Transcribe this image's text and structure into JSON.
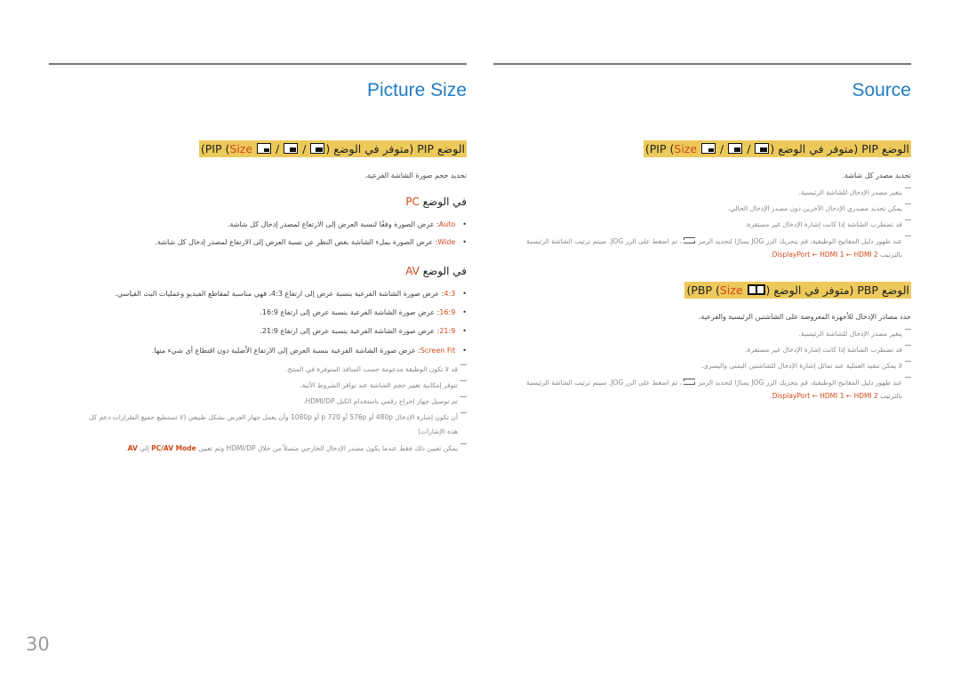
{
  "page_number": "30",
  "colors": {
    "title": "#1f7cc4",
    "highlight": "#ecc95a",
    "accent": "#d14a1a"
  },
  "left": {
    "title": "Picture Size",
    "heading": {
      "text": "الوضع PIP (متوفر في الوضع PIP (",
      "size_label": "Size",
      "sep": " / ",
      "close": "))"
    },
    "description": "تحديد حجم صورة الشاشة الفرعية.",
    "pc_heading": {
      "prefix": "في الوضع ",
      "mode": "PC"
    },
    "pc_items": [
      {
        "key": "Auto",
        "text": ": عرض الصورة وفقًا لنسبة العرض إلى الارتفاع لمصدر إدخال كل شاشة."
      },
      {
        "key": "Wide",
        "text": ": عرض الصورة بملء الشاشة بغض النظر عن نسبة العرض إلى الارتفاع لمصدر إدخال كل شاشة."
      }
    ],
    "av_heading": {
      "prefix": "في الوضع ",
      "mode": "AV"
    },
    "av_items": [
      {
        "key": "4:3",
        "text": ": عرض صورة الشاشة الفرعية بنسبة عرض إلى ارتفاع 4:3، فهي مناسبة لمقاطع الفيديو وعمليات البث القياسي."
      },
      {
        "key": "16:9",
        "text": ": عرض صورة الشاشة الفرعية بنسبة عرض إلى ارتفاع 16:9."
      },
      {
        "key": "21:9",
        "text": ": عرض صورة الشاشة الفرعية بنسبة عرض إلى ارتفاع 21:9."
      },
      {
        "key": "Screen Fit",
        "text": ": عرض صورة الشاشة الفرعية بنسبة العرض إلى الارتفاع الأصلية دون اقتطاع أي شيء منها."
      }
    ],
    "notes": [
      "قد لا تكون الوظيفة مدعومة حسب المنافذ المتوفرة في المنتج.",
      "تتوفر إمكانية تغيير حجم الشاشة عند توافر الشروط الآتية.",
      "تم توصيل جهاز إخراج رقمي باستخدام الكبل HDMI/DP.",
      "أن تكون إشارة الإدخال 480p أو 576p أو 720 p أو 1080p وأن يعمل جهاز العرض بشكل طبيعي (لا تستطيع جميع الطرازات دعم كل",
      "هذه الإشارات)"
    ],
    "last_note": {
      "text": "يمكن تعيين ذلك فقط عندما يكون مصدر الإدخال الخارجي متصلاً من خلال HDMI/DP وتم تعيين ",
      "key1": "PC/AV Mode",
      "mid": " إلى ",
      "key2": "AV",
      "end": "."
    }
  },
  "right": {
    "title": "Source",
    "pip_heading": {
      "text": "الوضع PIP (متوفر في الوضع PIP (",
      "size_label": "Size",
      "sep": " / ",
      "close": "))"
    },
    "pip_description": "تحديد مصدر كل شاشة.",
    "pip_notes": [
      "يتغير مصدر الإدخال للشاشة الرئيسية.",
      "يمكن تحديد مصدري الإدخال الآخرين دون مصدر الإدخال الحالي.",
      "قد تضطرب الشاشة إذا كانت إشارة الإدخال غير مستقرة."
    ],
    "pip_jog_note": {
      "before": "عند ظهور دليل المفاتيح الوظيفية، قم بتحريك الزر JOG يسارًا لتحديد الرمز ",
      "after": "، ثم اضغط على الزر JOG. سيتم ترتيب الشاشة الرئيسية",
      "line2_prefix": "بالترتيب ",
      "order": "DisplayPort ← HDMI 1 ← HDMI 2",
      "end": "."
    },
    "pbp_heading": {
      "text": "الوضع PBP (متوفر في الوضع PBP (",
      "size_label": "Size",
      "close": "))"
    },
    "pbp_description": "حدد مصادر الإدخال للأجهزة المعروضة على الشاشتين الرئيسية والفرعية.",
    "pbp_notes": [
      "يتغير مصدر الإدخال للشاشة الرئيسية.",
      "قد تضطرب الشاشة إذا كانت إشارة الإدخال غير مستقرة.",
      "لا يمكن تنفيذ العملية عند تماثل إشارة الإدخال للشاشتين اليمنى واليسرى."
    ],
    "pbp_jog_note": {
      "before": "عند ظهور دليل المفاتيح الوظيفية، قم بتحريك الزر JOG يسارًا لتحديد الرمز ",
      "after": "، ثم اضغط على الزر JOG. سيتم ترتيب الشاشة الرئيسية",
      "line2_prefix": "بالترتيب ",
      "order": "DisplayPort ← HDMI 1 ← HDMI 2",
      "end": "."
    }
  }
}
